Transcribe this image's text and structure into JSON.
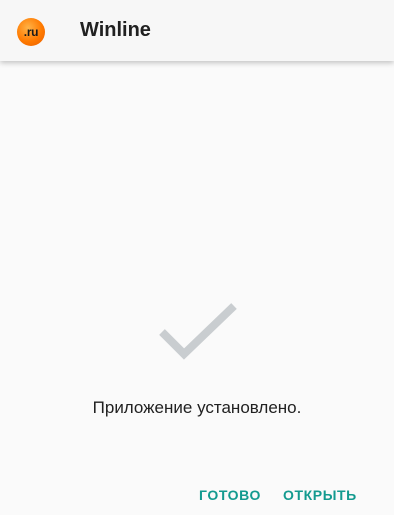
{
  "header": {
    "app_icon": "winline-ru-logo",
    "app_icon_text": ".ru",
    "title": "Winline"
  },
  "main": {
    "status_icon": "checkmark-icon",
    "status_text": "Приложение установлено."
  },
  "actions": {
    "done_label": "ГОТОВО",
    "open_label": "ОТКРЫТЬ"
  },
  "colors": {
    "accent": "#139a8f",
    "check": "#c9cdd0",
    "icon_orange": "#ff7a00"
  }
}
